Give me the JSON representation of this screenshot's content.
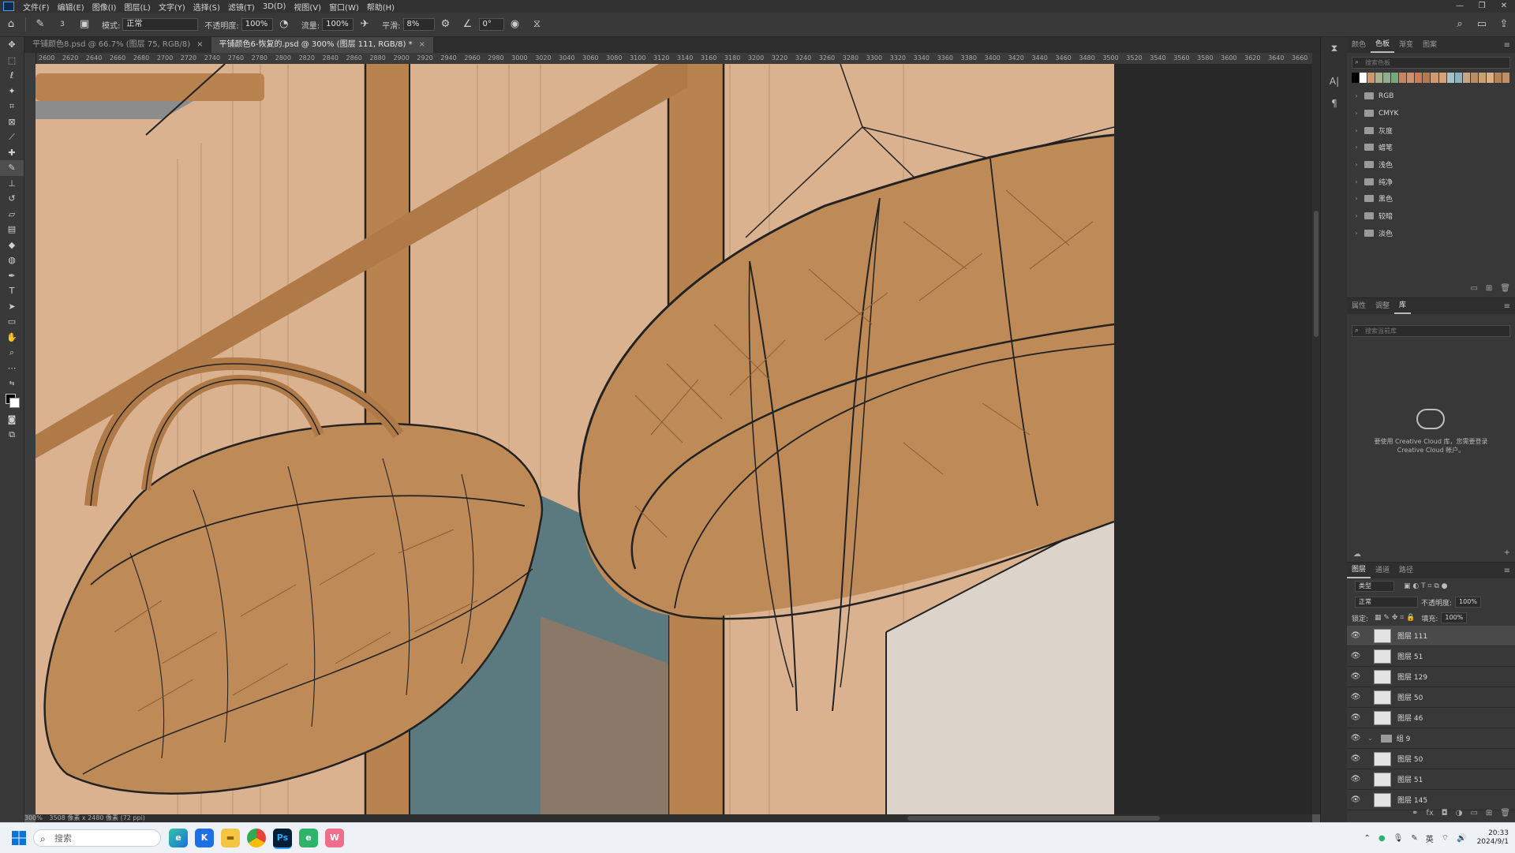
{
  "app": {
    "name": "Photoshop"
  },
  "menu": [
    "文件(F)",
    "编辑(E)",
    "图像(I)",
    "图层(L)",
    "文字(Y)",
    "选择(S)",
    "滤镜(T)",
    "3D(D)",
    "视图(V)",
    "窗口(W)",
    "帮助(H)"
  ],
  "options_bar": {
    "mode_label": "模式:",
    "mode_value": "正常",
    "opacity_label": "不透明度:",
    "opacity_value": "100%",
    "flow_label": "流量:",
    "flow_value": "100%",
    "smoothing_label": "平滑:",
    "smoothing_value": "8%",
    "angle_value": "0°",
    "brush_size": "3"
  },
  "tabs": [
    {
      "label": "平铺颜色8.psd @ 66.7% (图层 75, RGB/8)",
      "active": false
    },
    {
      "label": "平铺颜色6-恢复的.psd @ 300% (图层 111, RGB/8) *",
      "active": true
    }
  ],
  "ruler": {
    "h_ticks": [
      "2600",
      "2620",
      "2640",
      "2660",
      "2680",
      "2700",
      "2720",
      "2740",
      "2760",
      "2780",
      "2800",
      "2820",
      "2840",
      "2860",
      "2880",
      "2900",
      "2920",
      "2940",
      "2960",
      "2980",
      "3000",
      "3020",
      "3040",
      "3060",
      "3080",
      "3100",
      "3120",
      "3140",
      "3160",
      "3180",
      "3200",
      "3220",
      "3240",
      "3260",
      "3280",
      "3300",
      "3320",
      "3340",
      "3360",
      "3380",
      "3400",
      "3420",
      "3440",
      "3460",
      "3480",
      "3500",
      "3520",
      "3540",
      "3560",
      "3580",
      "3600",
      "3620",
      "3640",
      "3660"
    ]
  },
  "status": {
    "zoom": "300%",
    "doc_size": "3508 像素 x 2480 像素 (72 ppi)"
  },
  "panels": {
    "swatches": {
      "tabs": [
        "颜色",
        "色板",
        "渐变",
        "图案"
      ],
      "active_tab": "色板",
      "search_placeholder": "搜索色板",
      "colors": [
        "#000000",
        "#ffffff",
        "#c89a6a",
        "#a9b18a",
        "#8fb08a",
        "#79a67a",
        "#c9855d",
        "#d18f6a",
        "#c97c55",
        "#b9794f",
        "#cf9a72",
        "#d7a27a",
        "#a8c0c8",
        "#8db2c0",
        "#c8a584",
        "#b88e66",
        "#c9a06f",
        "#d8b08a",
        "#b48356",
        "#c09066"
      ],
      "groups": [
        "RGB",
        "CMYK",
        "灰度",
        "蜡笔",
        "浅色",
        "纯净",
        "黑色",
        "较暗",
        "淡色"
      ]
    },
    "libraries": {
      "tabs": [
        "属性",
        "调整",
        "库"
      ],
      "active_tab": "库",
      "search_placeholder": "搜索当前库",
      "message_line1": "要使用 Creative Cloud 库，您需要登录",
      "message_line2": "Creative Cloud 帐户。"
    },
    "layers": {
      "tabs": [
        "图层",
        "通道",
        "路径"
      ],
      "active_tab": "图层",
      "filter_label": "类型",
      "blend_mode": "正常",
      "opacity_label": "不透明度:",
      "opacity_value": "100%",
      "lock_label": "锁定:",
      "fill_label": "填充:",
      "fill_value": "100%",
      "items": [
        {
          "name": "图层 111",
          "selected": true,
          "group": false
        },
        {
          "name": "图层 51",
          "selected": false,
          "group": false
        },
        {
          "name": "图层 129",
          "selected": false,
          "group": false
        },
        {
          "name": "图层 50",
          "selected": false,
          "group": false
        },
        {
          "name": "图层 46",
          "selected": false,
          "group": false
        },
        {
          "name": "组 9",
          "selected": false,
          "group": true
        },
        {
          "name": "图层 50",
          "selected": false,
          "group": false
        },
        {
          "name": "图层 51",
          "selected": false,
          "group": false
        },
        {
          "name": "图层 145",
          "selected": false,
          "group": false
        }
      ]
    }
  },
  "taskbar": {
    "search_placeholder": "搜索",
    "apps": [
      "edge",
      "tencent-app",
      "explorer",
      "chrome",
      "photoshop",
      "ebook-app",
      "pink-app"
    ],
    "ime": "英",
    "time": "20:33",
    "date": "2024/9/1"
  },
  "colors": {
    "wall": "#dab28f",
    "wood": "#b8834e",
    "basket": "#be8a58",
    "window_blue": "#5a7a7f",
    "white_wall": "#dcd4cb"
  }
}
